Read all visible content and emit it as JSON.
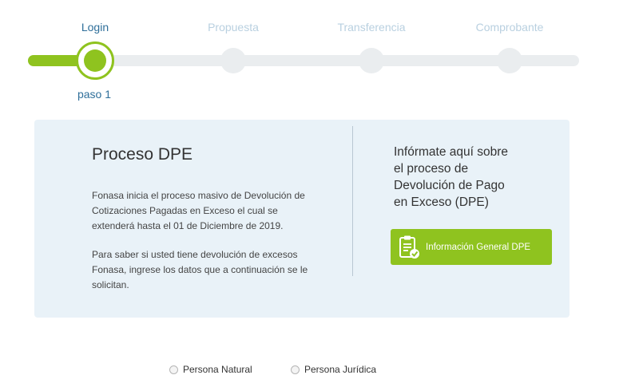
{
  "stepper": {
    "steps": [
      {
        "label": "Login",
        "active": true
      },
      {
        "label": "Propuesta",
        "active": false
      },
      {
        "label": "Transferencia",
        "active": false
      },
      {
        "label": "Comprobante",
        "active": false
      }
    ],
    "current_step_text": "paso 1"
  },
  "panel": {
    "title": "Proceso DPE",
    "paragraph1_line1": "Fonasa inicia el proceso masivo de Devolución de",
    "paragraph1_line2": "Cotizaciones Pagadas en Exceso el cual se",
    "paragraph1_line3": "extenderá hasta el 01 de Diciembre de 2019.",
    "paragraph2_line1": "Para saber si usted tiene devolución de excesos",
    "paragraph2_line2": "Fonasa, ingrese los datos que a continuación se le",
    "paragraph2_line3": "solicitan.",
    "right_title_line1": "Infórmate aquí sobre",
    "right_title_line2": "el proceso de",
    "right_title_line3": "Devolución de Pago",
    "right_title_line4": "en Exceso (DPE)",
    "button_label": "Información General DPE",
    "button_icon": "clipboard-check-icon"
  },
  "person_type": {
    "options": [
      "Persona Natural",
      "Persona Jurídica"
    ]
  },
  "colors": {
    "accent_green": "#8fc31f",
    "step_active": "#2f6f9a",
    "step_inactive": "#b9d0e0",
    "panel_bg": "#e9f2f8"
  }
}
